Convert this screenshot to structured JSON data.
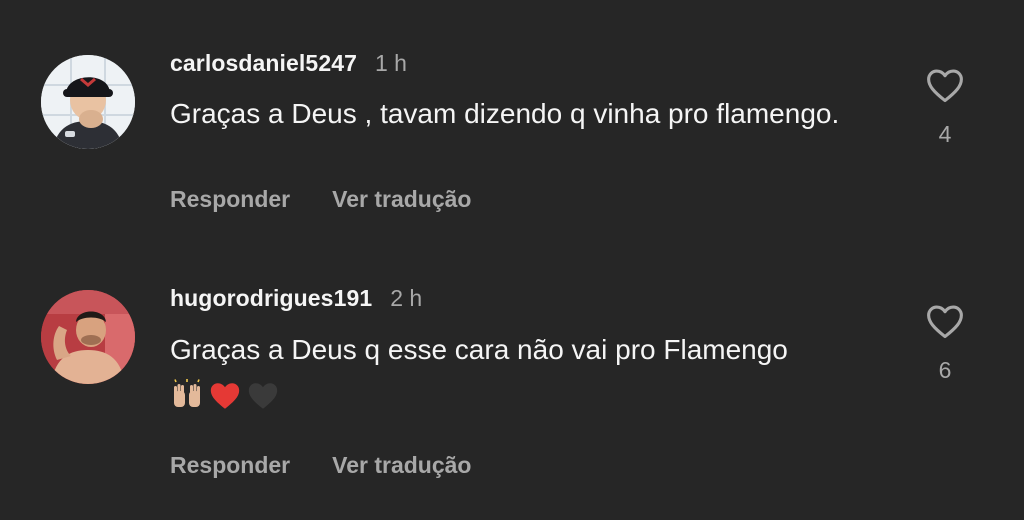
{
  "comments": [
    {
      "username": "carlosdaniel5247",
      "time": "1 h",
      "text": "Graças a Deus , tavam dizendo q vinha pro flamengo.",
      "emojis": [],
      "reply_label": "Responder",
      "translate_label": "Ver tradução",
      "likes": "4"
    },
    {
      "username": "hugorodrigues191",
      "time": "2 h",
      "text": "Graças a Deus q esse cara não vai pro Flamengo",
      "emojis": [
        "raising-hands-emoji",
        "red-heart-emoji",
        "black-heart-emoji"
      ],
      "reply_label": "Responder",
      "translate_label": "Ver tradução",
      "likes": "6"
    }
  ],
  "colors": {
    "background": "#262626",
    "primary_text": "#f5f5f5",
    "secondary_text": "#a8a8a8",
    "heart_outline": "#a8a8a8"
  }
}
